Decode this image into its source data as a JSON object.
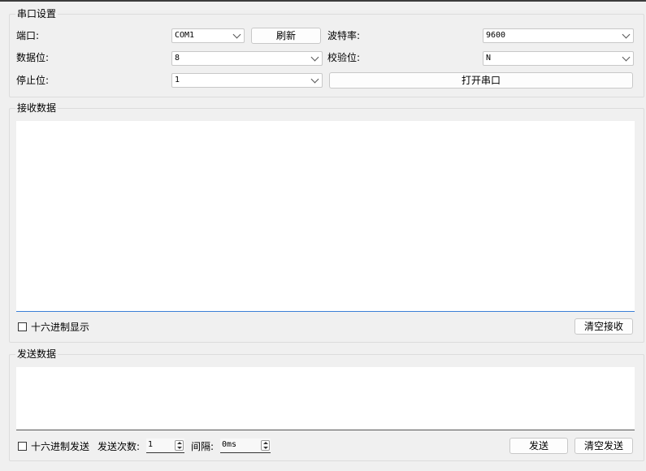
{
  "serial_settings": {
    "title": "串口设置",
    "port_label": "端口:",
    "port_value": "COM1",
    "refresh_button": "刷新",
    "baud_label": "波特率:",
    "baud_value": "9600",
    "databits_label": "数据位:",
    "databits_value": "8",
    "parity_label": "校验位:",
    "parity_value": "N",
    "stopbits_label": "停止位:",
    "stopbits_value": "1",
    "open_button": "打开串口"
  },
  "receive": {
    "title": "接收数据",
    "content": "",
    "hex_display_label": "十六进制显示",
    "hex_display_checked": false,
    "clear_button": "清空接收"
  },
  "send": {
    "title": "发送数据",
    "content": "",
    "hex_send_label": "十六进制发送",
    "hex_send_checked": false,
    "count_label": "发送次数:",
    "count_value": "1",
    "interval_label": "间隔:",
    "interval_value": "0ms",
    "send_button": "发送",
    "clear_button": "清空发送"
  },
  "colors": {
    "window_bg": "#f0f0f0",
    "focus_line": "#3b7fd6"
  }
}
